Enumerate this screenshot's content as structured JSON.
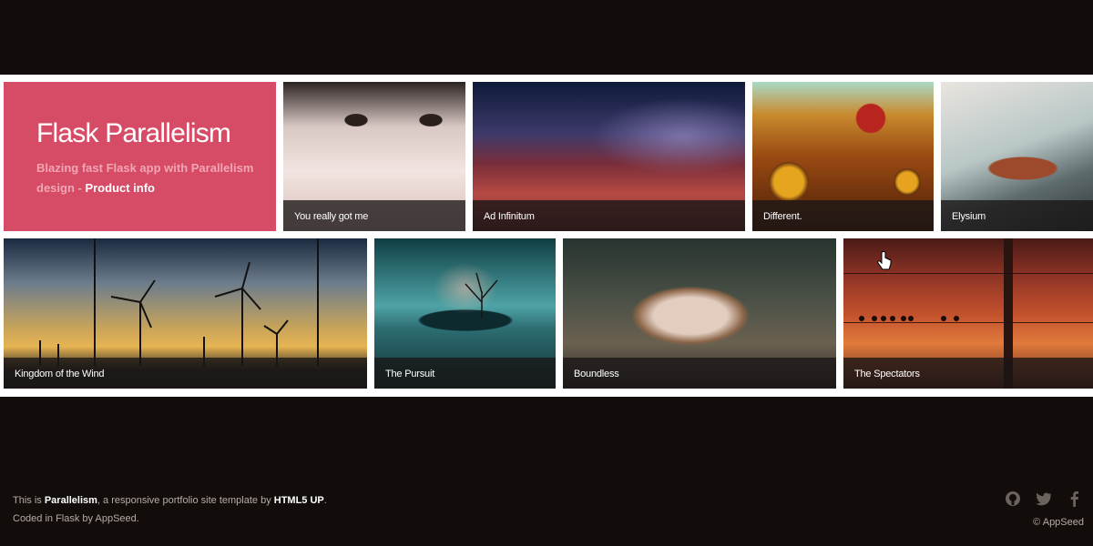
{
  "intro": {
    "title": "Flask Parallelism",
    "subtitle": "Blazing fast Flask app with Parallelism design - ",
    "link": "Product info"
  },
  "tiles": [
    {
      "caption": "You really got me"
    },
    {
      "caption": "Ad Infinitum"
    },
    {
      "caption": "Different."
    },
    {
      "caption": "Elysium"
    },
    {
      "caption": "Kingdom of the Wind"
    },
    {
      "caption": "The Pursuit"
    },
    {
      "caption": "Boundless"
    },
    {
      "caption": "The Spectators"
    }
  ],
  "footer": {
    "prefix": "This is ",
    "brand": "Parallelism",
    "mid": ", a responsive portfolio site template by ",
    "author": "HTML5 UP",
    "end": ".",
    "line2": "Coded in Flask by AppSeed.",
    "copyright": "© AppSeed"
  },
  "icons": [
    "github-icon",
    "twitter-icon",
    "facebook-icon"
  ],
  "colors": {
    "background": "#120d0a",
    "accent": "#d64b66",
    "strip": "#ffffff"
  }
}
